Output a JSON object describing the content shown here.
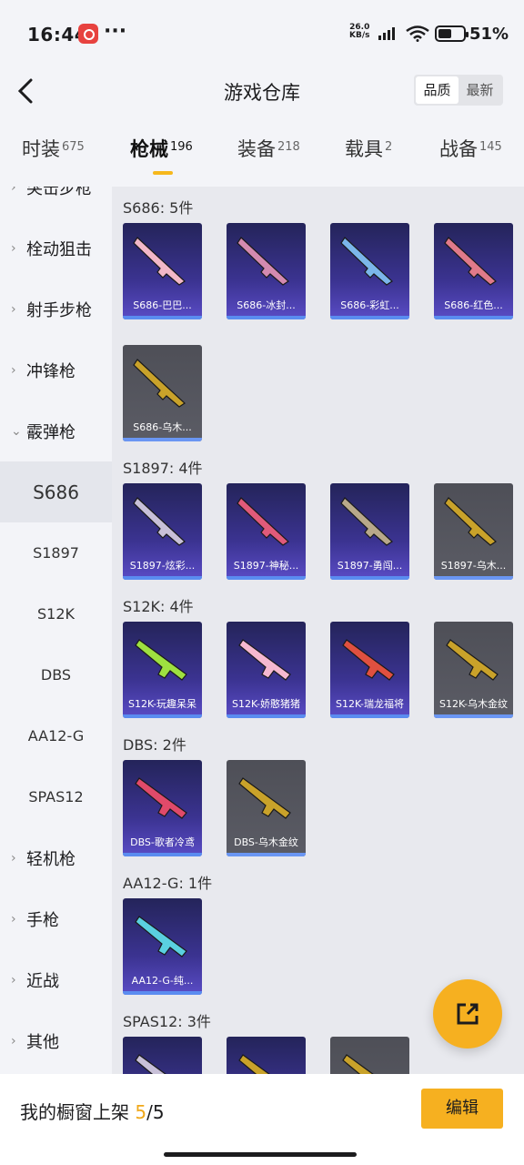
{
  "status_bar": {
    "time": "16:44",
    "dots": "···",
    "speed_value": "26.0",
    "speed_unit": "KB/s",
    "battery": "51%"
  },
  "header": {
    "title": "游戏仓库",
    "sort_quality": "品质",
    "sort_latest": "最新"
  },
  "tabs": [
    {
      "label": "时装",
      "count": "675"
    },
    {
      "label": "枪械",
      "count": "196"
    },
    {
      "label": "装备",
      "count": "218"
    },
    {
      "label": "载具",
      "count": "2"
    },
    {
      "label": "战备",
      "count": "145"
    }
  ],
  "sidebar": {
    "partial": "突击步枪",
    "items": [
      "栓动狙击",
      "射手步枪",
      "冲锋枪",
      "霰弹枪"
    ],
    "subs": [
      "S686",
      "S1897",
      "S12K",
      "DBS",
      "AA12-G",
      "SPAS12"
    ],
    "more": [
      "轻机枪",
      "手枪",
      "近战",
      "其他"
    ]
  },
  "sections": [
    {
      "title": "S686: 5件",
      "items": [
        {
          "name": "S686-巴巴...",
          "style": "purple",
          "color": "#f2b8c8"
        },
        {
          "name": "S686-冰封...",
          "style": "purple",
          "color": "#d48ab0"
        },
        {
          "name": "S686-彩虹...",
          "style": "purple",
          "color": "#7bb6ea"
        },
        {
          "name": "S686-红色...",
          "style": "purple",
          "color": "#e07a8a"
        },
        {
          "name": "S686-乌木...",
          "style": "gray",
          "color": "#c9a22a"
        }
      ]
    },
    {
      "title": "S1897: 4件",
      "items": [
        {
          "name": "S1897-炫彩...",
          "style": "purple",
          "color": "#c8c0d8"
        },
        {
          "name": "S1897-神秘...",
          "style": "purple",
          "color": "#e05a7a"
        },
        {
          "name": "S1897-勇闯...",
          "style": "purple",
          "color": "#b8a88a"
        },
        {
          "name": "S1897-乌木...",
          "style": "gray",
          "color": "#c9a22a"
        }
      ]
    },
    {
      "title": "S12K: 4件",
      "items": [
        {
          "name": "S12K-玩趣呆呆",
          "style": "purple",
          "color": "#9ee040"
        },
        {
          "name": "S12K-娇憨猪猪",
          "style": "purple",
          "color": "#f5b8d0"
        },
        {
          "name": "S12K-瑞龙福将",
          "style": "purple",
          "color": "#e05040"
        },
        {
          "name": "S12K-乌木金纹",
          "style": "gray",
          "color": "#c9a22a"
        }
      ]
    },
    {
      "title": "DBS: 2件",
      "items": [
        {
          "name": "DBS-歌者冷鸢",
          "style": "purple",
          "color": "#e04a6a"
        },
        {
          "name": "DBS-乌木金纹",
          "style": "gray",
          "color": "#c9a22a"
        }
      ]
    },
    {
      "title": "AA12-G: 1件",
      "items": [
        {
          "name": "AA12-G-纯...",
          "style": "purple",
          "color": "#5ad0e0"
        }
      ]
    },
    {
      "title": "SPAS12: 3件",
      "items": [
        {
          "name": "",
          "style": "purple",
          "color": "#c8c0d8"
        },
        {
          "name": "",
          "style": "purple",
          "color": "#c9a22a"
        },
        {
          "name": "",
          "style": "gray",
          "color": "#c9a22a"
        }
      ]
    }
  ],
  "bottom_bar": {
    "shelf_label": "我的橱窗上架 ",
    "shelf_count": "5",
    "shelf_total": "/5",
    "edit_label": "编辑"
  },
  "colors": {
    "accent": "#f6b020",
    "card_purple": "#3b3391",
    "card_gray": "#55565e"
  }
}
